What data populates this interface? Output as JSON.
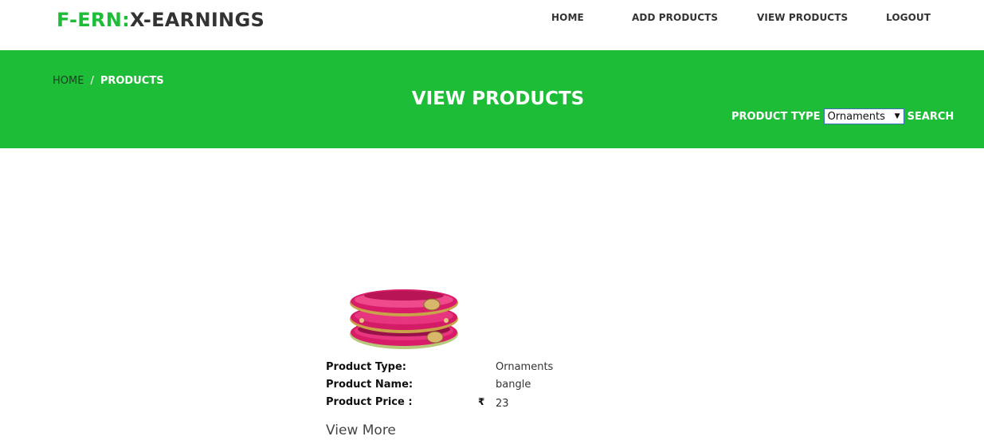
{
  "brand": {
    "part1": "F-ERN:",
    "part2": "X-EARNINGS",
    "accent": "#1ebd38"
  },
  "nav": {
    "home": "HOME",
    "add_products": "ADD PRODUCTS",
    "view_products": "VIEW PRODUCTS",
    "logout": "LOGOUT"
  },
  "banner": {
    "background": "#1ebd38",
    "breadcrumb": {
      "home": "HOME",
      "separator": "/",
      "current": "PRODUCTS"
    },
    "title": "VIEW PRODUCTS",
    "filter": {
      "label": "PRODUCT TYPE",
      "selected": "Ornaments",
      "search_label": "SEARCH"
    }
  },
  "product": {
    "image_icon": "bangle-image",
    "type_label": "Product Type:",
    "type_value": "Ornaments",
    "name_label": "Product Name:",
    "name_value": "bangle",
    "price_label": "Product Price :",
    "currency_symbol": "₹",
    "price_value": "23",
    "view_more": "View More"
  }
}
